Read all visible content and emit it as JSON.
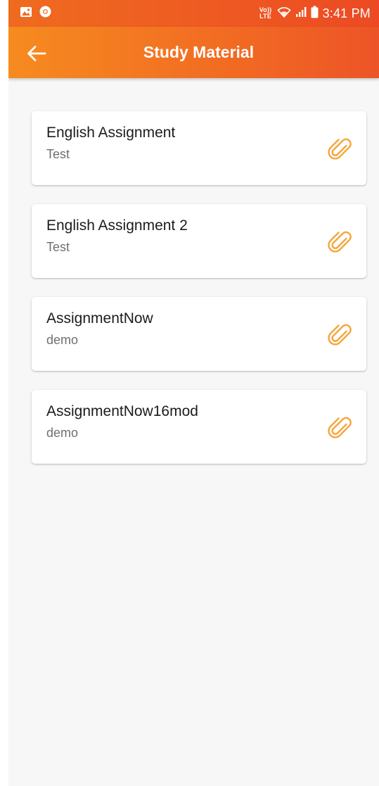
{
  "status_bar": {
    "time": "3:41 PM",
    "network_label": "Vo)) LTE",
    "icons": [
      "gallery-icon",
      "chrome-icon",
      "volte-icon",
      "wifi-icon",
      "signal-icon",
      "battery-icon"
    ]
  },
  "app_bar": {
    "title": "Study Material",
    "back_icon": "arrow-left-icon"
  },
  "items": [
    {
      "title": "English Assignment",
      "subtitle": "Test",
      "icon": "paperclip-icon"
    },
    {
      "title": "English Assignment 2",
      "subtitle": "Test",
      "icon": "paperclip-icon"
    },
    {
      "title": "AssignmentNow",
      "subtitle": "demo",
      "icon": "paperclip-icon"
    },
    {
      "title": "AssignmentNow16mod",
      "subtitle": "demo",
      "icon": "paperclip-icon"
    }
  ],
  "colors": {
    "header_start": "#f68b1f",
    "header_end": "#ed5427",
    "accent_icon": "#f4a63a",
    "background": "#f7f7f7"
  }
}
